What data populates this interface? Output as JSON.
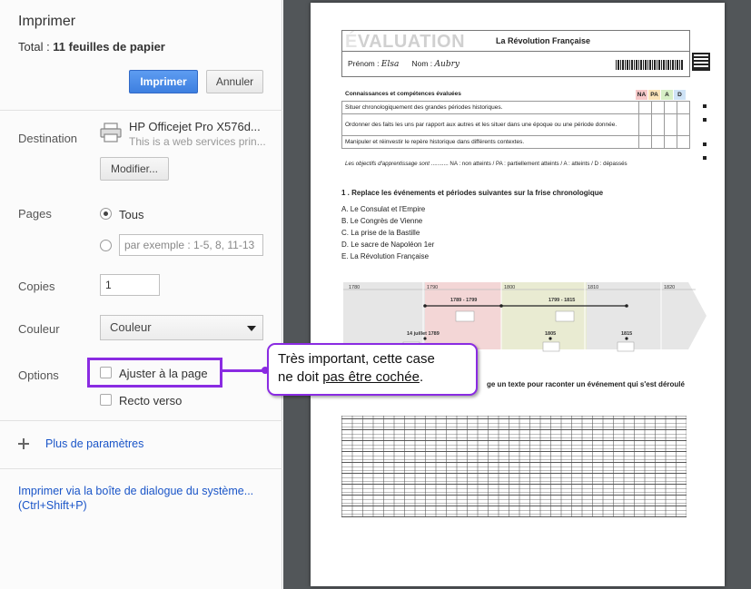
{
  "panel": {
    "title": "Imprimer",
    "total_prefix": "Total : ",
    "total_value": "11 feuilles de papier",
    "print_button": "Imprimer",
    "cancel_button": "Annuler",
    "destination": {
      "label": "Destination",
      "printer_name": "HP Officejet Pro X576d...",
      "printer_sub": "This is a web services prin...",
      "change_button": "Modifier..."
    },
    "pages": {
      "label": "Pages",
      "option_all": "Tous",
      "range_placeholder": "par exemple : 1-5, 8, 11-13"
    },
    "copies": {
      "label": "Copies",
      "value": "1"
    },
    "color": {
      "label": "Couleur",
      "selected": "Couleur"
    },
    "options": {
      "label": "Options",
      "fit_page": "Ajuster à la page",
      "duplex": "Recto verso"
    },
    "more_settings": "Plus de paramètres",
    "system_dialog_line1": "Imprimer via la boîte de dialogue du système...",
    "system_dialog_line2": "(Ctrl+Shift+P)"
  },
  "callout": {
    "line1": "Très important, cette case",
    "line2_prefix": "ne doit ",
    "line2_underlined": "pas être cochée",
    "line2_suffix": "."
  },
  "preview": {
    "eval_title_first": "É",
    "eval_title_rest": "VALUATION",
    "eval_subject": "La Révolution Française",
    "prenom_label": "Prénom :",
    "prenom_value": "Elsa",
    "nom_label": "Nom :",
    "nom_value": "Aubry",
    "competences_heading": "Connaissances et compétences évaluées",
    "badges": [
      "NA",
      "PA",
      "A",
      "D"
    ],
    "competences": [
      "Situer chronologiquement des grandes périodes historiques.",
      "Ordonner des faits les uns par rapport aux autres et les situer dans une époque ou une période donnée.",
      "Manipuler et réinvestir le repère historique dans différents contextes."
    ],
    "legend_prefix": "Les objectifs d'apprentissage sont",
    "legend_text": "........... NA : non atteints / PA : partiellement atteints / A : atteints / D : dépassés",
    "question1": "1 . Replace les événements et périodes suivantes sur la frise chronologique",
    "items": [
      "A. Le Consulat et l'Empire",
      "B. Le Congrès de Vienne",
      "C. La prise de la Bastille",
      "D. Le sacre de Napoléon 1er",
      "E. La Révolution Française"
    ],
    "timeline_years": [
      "1780",
      "1790",
      "1800",
      "1810",
      "1820"
    ],
    "period1": "1789 - 1799",
    "period2": "1799 - 1815",
    "event_dates": [
      "14 juillet 1789",
      "1805",
      "1815"
    ],
    "question2": "ge un texte pour raconter un événement qui s'est déroulé"
  },
  "colors": {
    "accent_purple": "#8a2be2",
    "primary_blue": "#3d7fe0",
    "preview_background": "#525659",
    "link_blue": "#1a55c8"
  }
}
